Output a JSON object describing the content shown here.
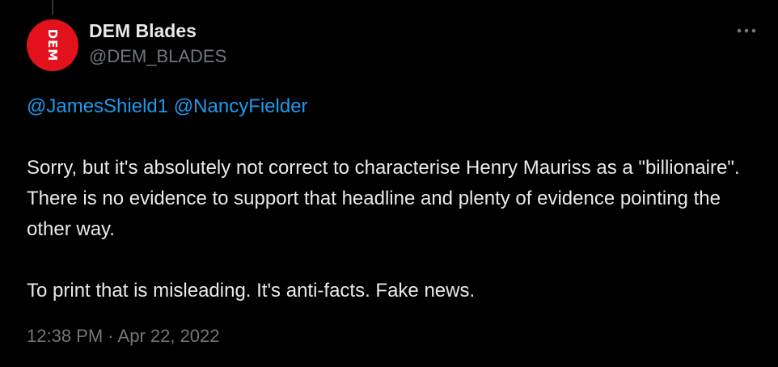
{
  "author": {
    "display_name": "DEM Blades",
    "handle": "@DEM_BLADES",
    "avatar_text": "DEM",
    "avatar_color": "#e3111b"
  },
  "tweet": {
    "mentions": [
      "@JamesShield1",
      "@NancyFielder"
    ],
    "paragraphs": [
      "Sorry, but it's absolutely not correct to characterise Henry Mauriss as a \"billionaire\". There is no evidence to support that headline and plenty of evidence pointing the other way.",
      "To print that is misleading. It's anti-facts. Fake news."
    ],
    "time": "12:38 PM",
    "separator": "·",
    "date": "Apr 22, 2022"
  },
  "icons": {
    "more": "more-horizontal-icon"
  },
  "colors": {
    "background": "#000000",
    "text": "#e7e9ea",
    "muted": "#71767b",
    "link": "#1d9bf0"
  }
}
